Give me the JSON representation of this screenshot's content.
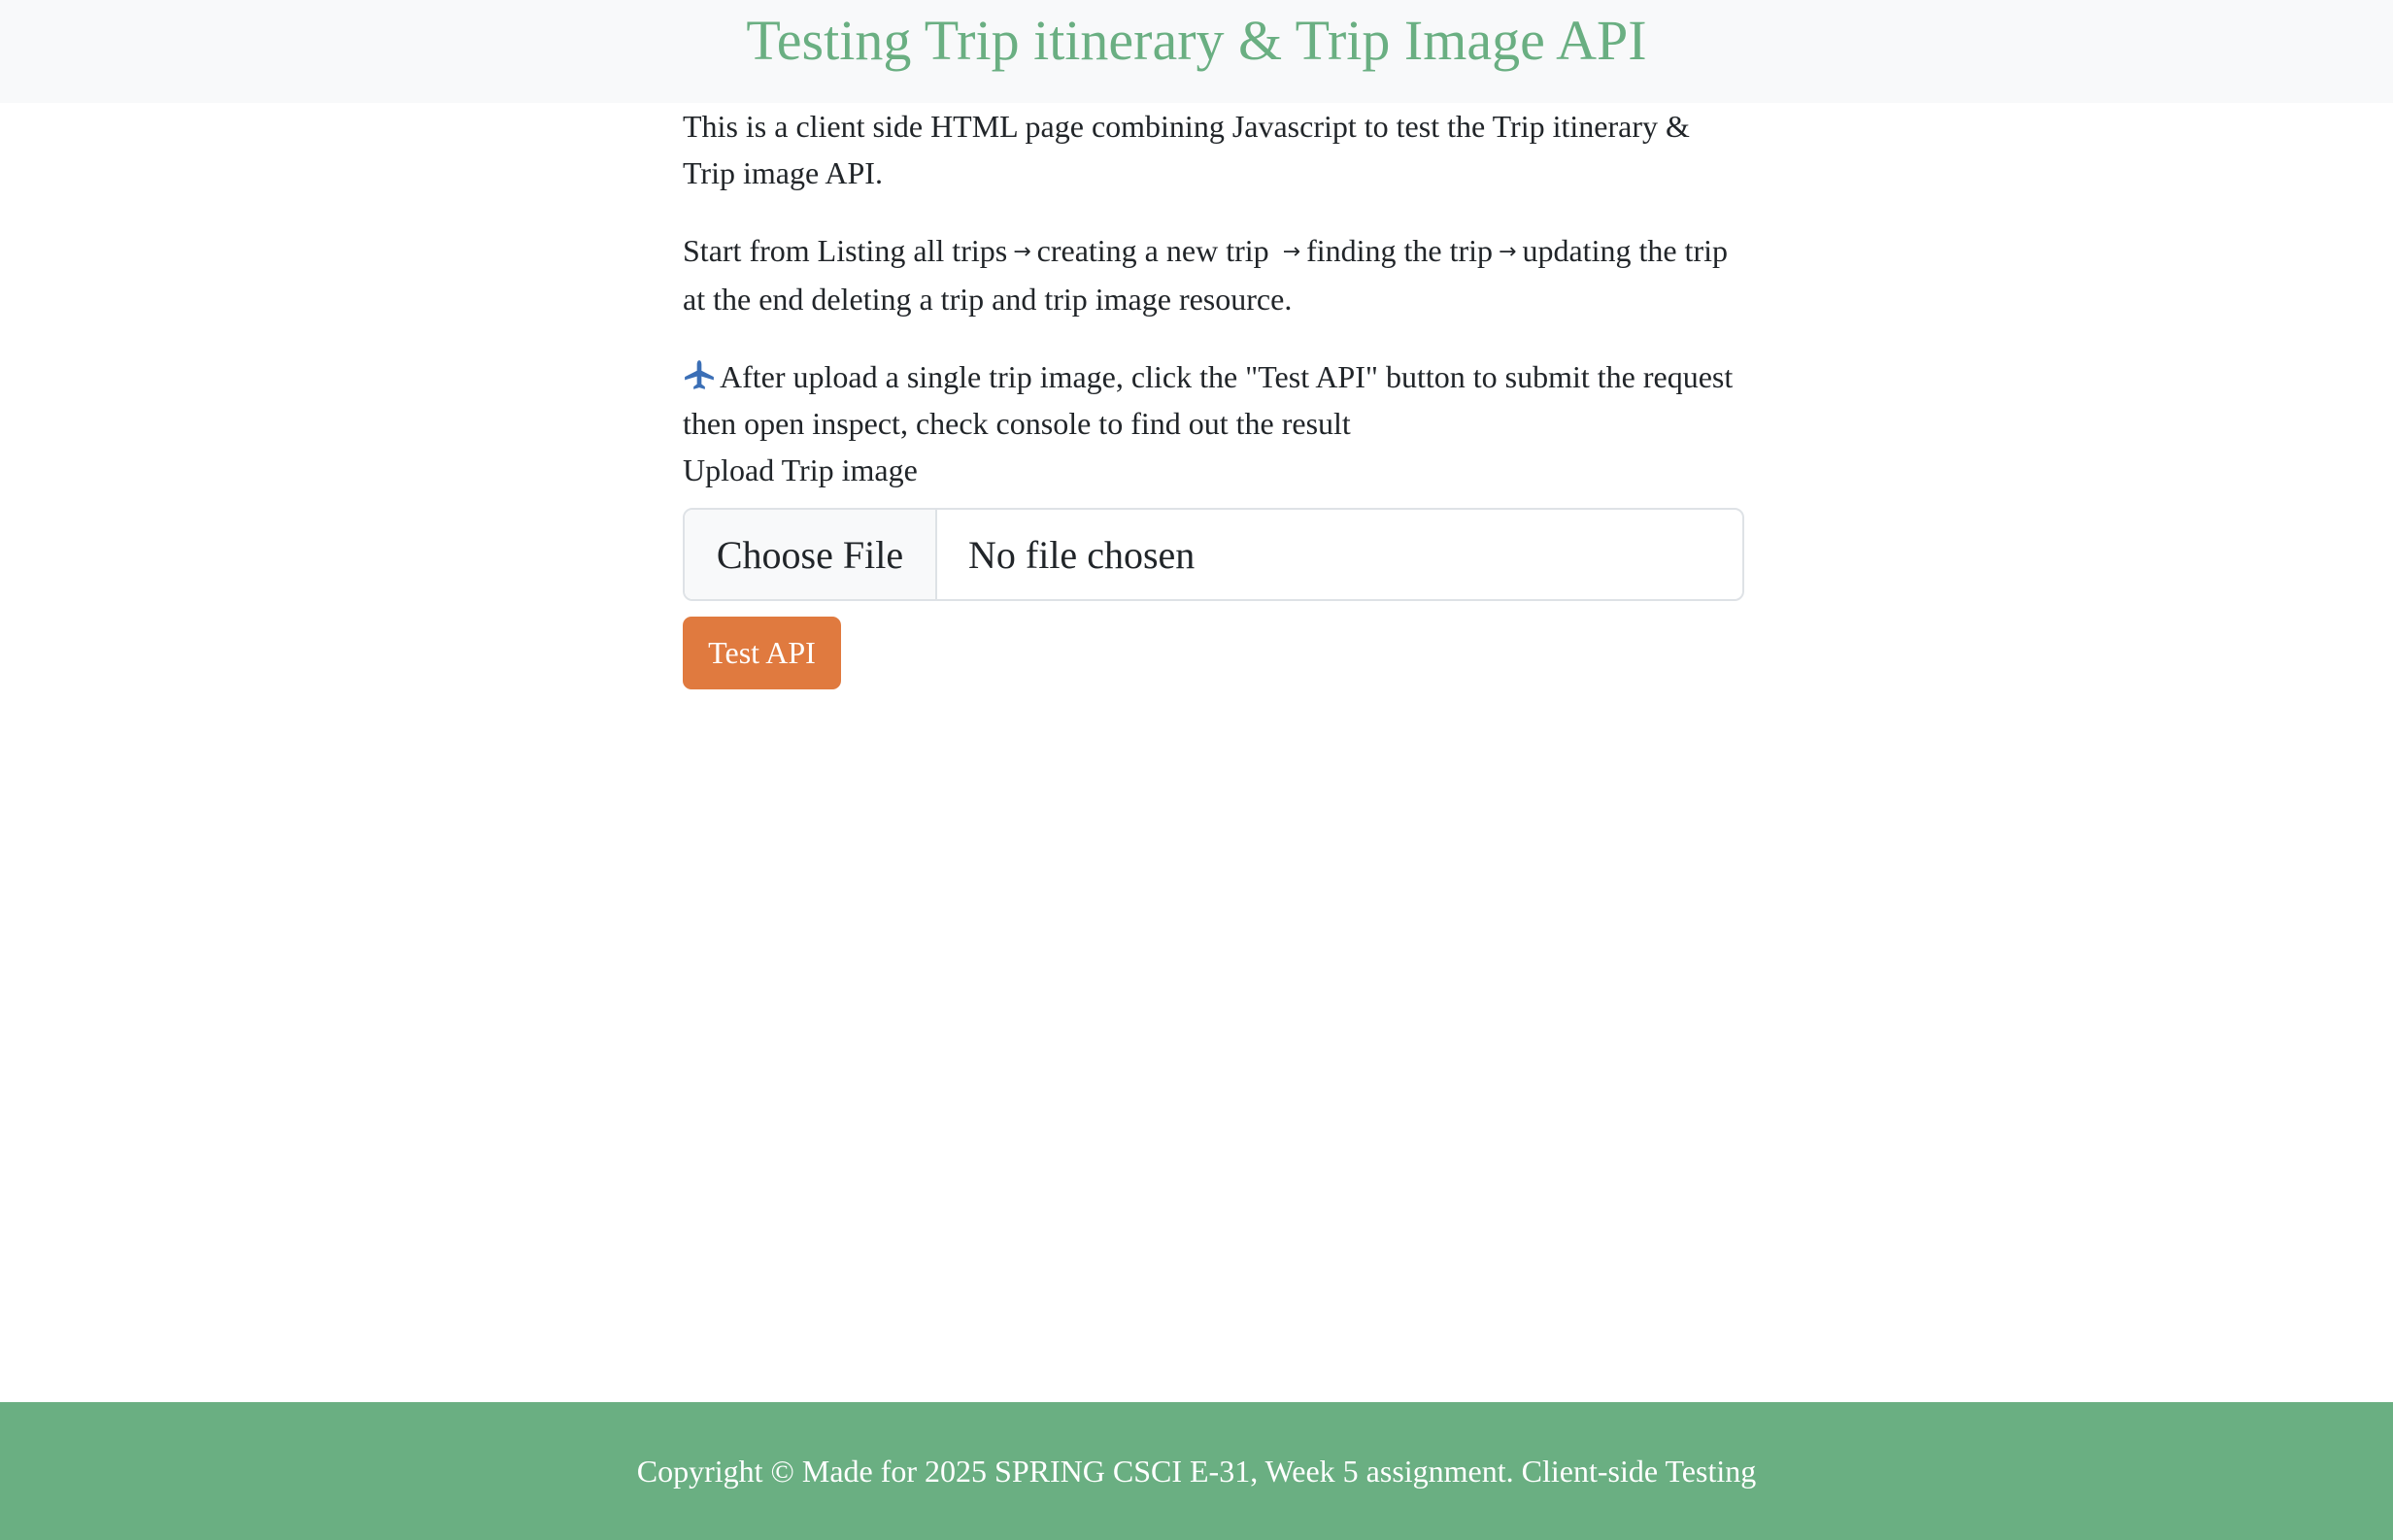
{
  "header": {
    "title": "Testing Trip itinerary & Trip Image API",
    "title_color": "#6aaf82"
  },
  "main": {
    "intro": "This is a client side HTML page combining Javascript to test the Trip itinerary & Trip image API.",
    "flow": {
      "step1": "Start from Listing all trips",
      "step2": "creating a new trip",
      "step3": "finding the trip",
      "step4": "updating the trip at the end deleting a trip and trip image resource.",
      "arrow": "→"
    },
    "instruction": {
      "icon": "airplane-icon",
      "text": "After upload a single trip image, click the \"Test API\" button to submit the request then open inspect, check console to find out the result"
    },
    "upload_label": "Upload Trip image",
    "file_input": {
      "button_label": "Choose File",
      "value": "No file chosen"
    },
    "test_button": {
      "label": "Test API",
      "color": "#e07a3f"
    }
  },
  "footer": {
    "text": "Copyright © Made for 2025 SPRING CSCI E-31, Week 5 assignment. Client-side Testing",
    "color": "#6aaf82"
  }
}
